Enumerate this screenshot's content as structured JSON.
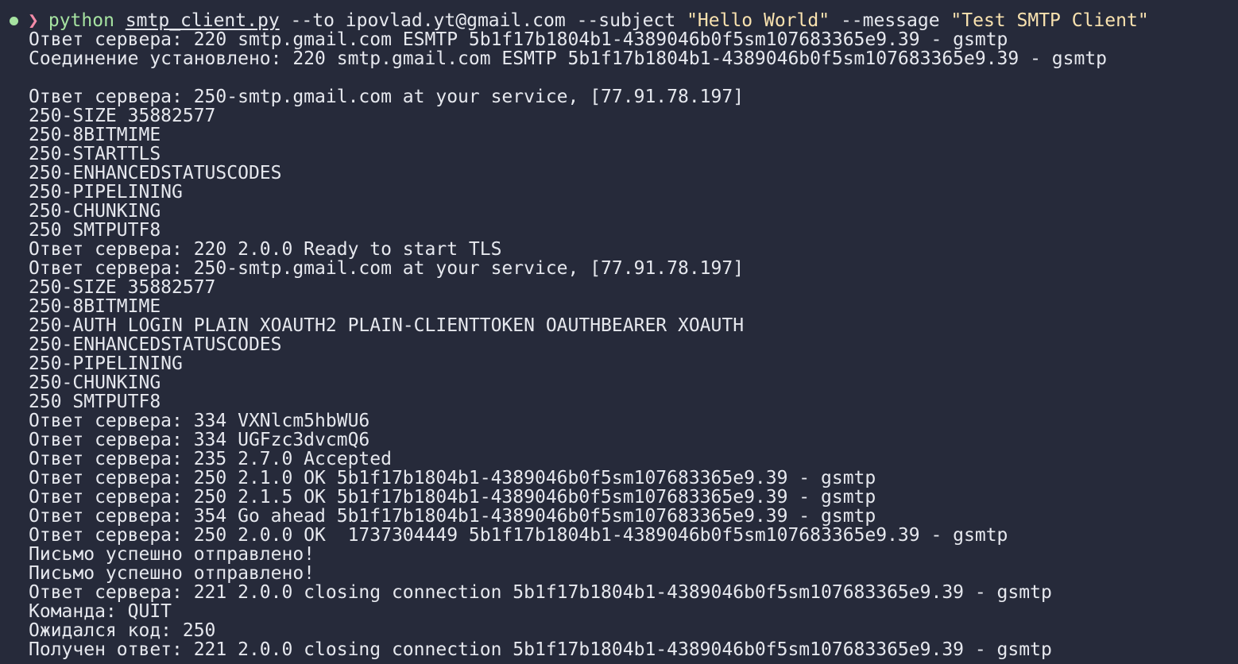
{
  "prompt": {
    "status_icon": "status-dot-icon",
    "caret_icon": "prompt-caret-icon",
    "command": "python",
    "file": "smtp_client.py",
    "args": [
      {
        "text": "--to ipovlad.yt@gmail.com --subject",
        "kind": "arg"
      },
      {
        "text": "\"Hello World\"",
        "kind": "str"
      },
      {
        "text": "--message",
        "kind": "arg"
      },
      {
        "text": "\"Test SMTP Client\"",
        "kind": "str"
      }
    ]
  },
  "output_lines": [
    "Ответ сервера: 220 smtp.gmail.com ESMTP 5b1f17b1804b1-4389046b0f5sm107683365e9.39 - gsmtp",
    "Соединение установлено: 220 smtp.gmail.com ESMTP 5b1f17b1804b1-4389046b0f5sm107683365e9.39 - gsmtp",
    "",
    "Ответ сервера: 250-smtp.gmail.com at your service, [77.91.78.197]",
    "250-SIZE 35882577",
    "250-8BITMIME",
    "250-STARTTLS",
    "250-ENHANCEDSTATUSCODES",
    "250-PIPELINING",
    "250-CHUNKING",
    "250 SMTPUTF8",
    "Ответ сервера: 220 2.0.0 Ready to start TLS",
    "Ответ сервера: 250-smtp.gmail.com at your service, [77.91.78.197]",
    "250-SIZE 35882577",
    "250-8BITMIME",
    "250-AUTH LOGIN PLAIN XOAUTH2 PLAIN-CLIENTTOKEN OAUTHBEARER XOAUTH",
    "250-ENHANCEDSTATUSCODES",
    "250-PIPELINING",
    "250-CHUNKING",
    "250 SMTPUTF8",
    "Ответ сервера: 334 VXNlcm5hbWU6",
    "Ответ сервера: 334 UGFzc3dvcmQ6",
    "Ответ сервера: 235 2.7.0 Accepted",
    "Ответ сервера: 250 2.1.0 OK 5b1f17b1804b1-4389046b0f5sm107683365e9.39 - gsmtp",
    "Ответ сервера: 250 2.1.5 OK 5b1f17b1804b1-4389046b0f5sm107683365e9.39 - gsmtp",
    "Ответ сервера: 354 Go ahead 5b1f17b1804b1-4389046b0f5sm107683365e9.39 - gsmtp",
    "Ответ сервера: 250 2.0.0 OK  1737304449 5b1f17b1804b1-4389046b0f5sm107683365e9.39 - gsmtp",
    "Письмо успешно отправлено!",
    "Письмо успешно отправлено!",
    "Ответ сервера: 221 2.0.0 closing connection 5b1f17b1804b1-4389046b0f5sm107683365e9.39 - gsmtp",
    "Команда: QUIT",
    "Ожидался код: 250",
    "Получен ответ: 221 2.0.0 closing connection 5b1f17b1804b1-4389046b0f5sm107683365e9.39 - gsmtp"
  ],
  "colors": {
    "background": "#262a3a",
    "foreground": "#e6e8ee",
    "command": "#a6e3a1",
    "string": "#f9e2af",
    "caret": "#f38ba8",
    "status_dot": "#a6e3a1"
  }
}
